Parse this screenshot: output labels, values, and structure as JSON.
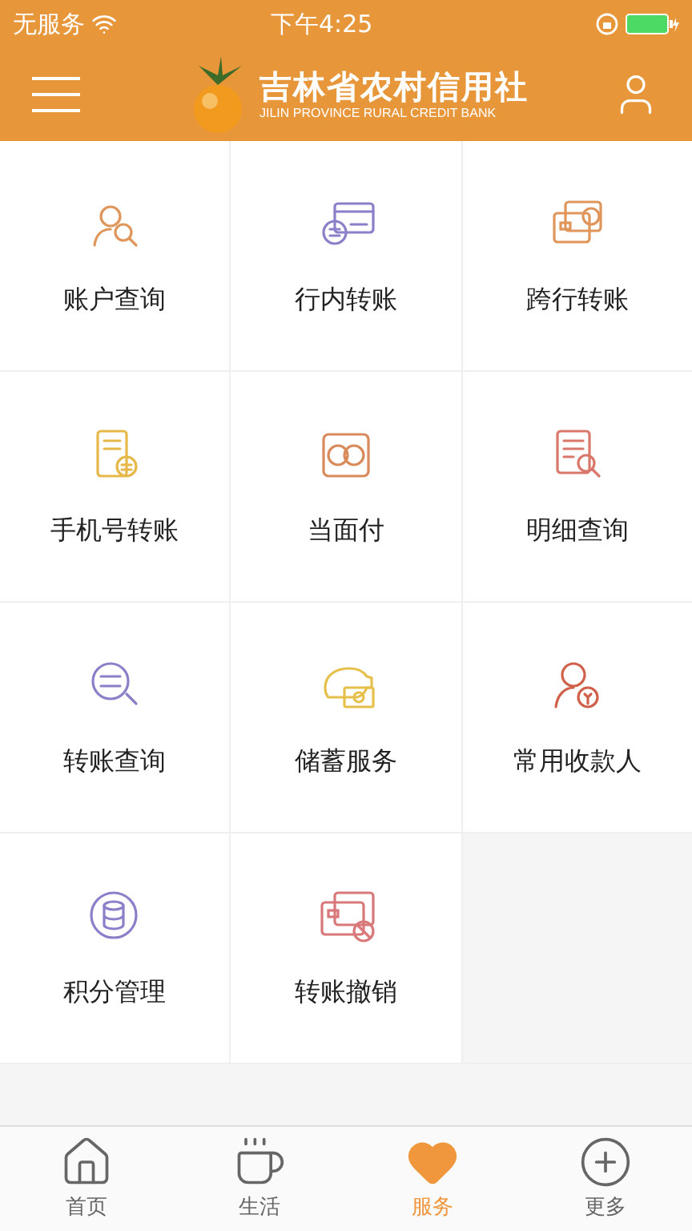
{
  "status_bar": {
    "carrier": "无服务",
    "time": "下午4:25"
  },
  "header": {
    "title": "吉林省农村信用社",
    "subtitle": "JILIN PROVINCE RURAL CREDIT BANK"
  },
  "services": [
    {
      "label": "账户查询",
      "color": "#e0955a"
    },
    {
      "label": "行内转账",
      "color": "#8a7fc9"
    },
    {
      "label": "跨行转账",
      "color": "#e0955a"
    },
    {
      "label": "手机号转账",
      "color": "#e6b84a"
    },
    {
      "label": "当面付",
      "color": "#d98a5a"
    },
    {
      "label": "明细查询",
      "color": "#d9786a"
    },
    {
      "label": "转账查询",
      "color": "#8a7fc9"
    },
    {
      "label": "储蓄服务",
      "color": "#e6c04a"
    },
    {
      "label": "常用收款人",
      "color": "#d0604a"
    },
    {
      "label": "积分管理",
      "color": "#8a7fc9"
    },
    {
      "label": "转账撤销",
      "color": "#d9787a"
    }
  ],
  "tab_bar": [
    {
      "label": "首页",
      "selected": false
    },
    {
      "label": "生活",
      "selected": false
    },
    {
      "label": "服务",
      "selected": true
    },
    {
      "label": "更多",
      "selected": false
    }
  ]
}
